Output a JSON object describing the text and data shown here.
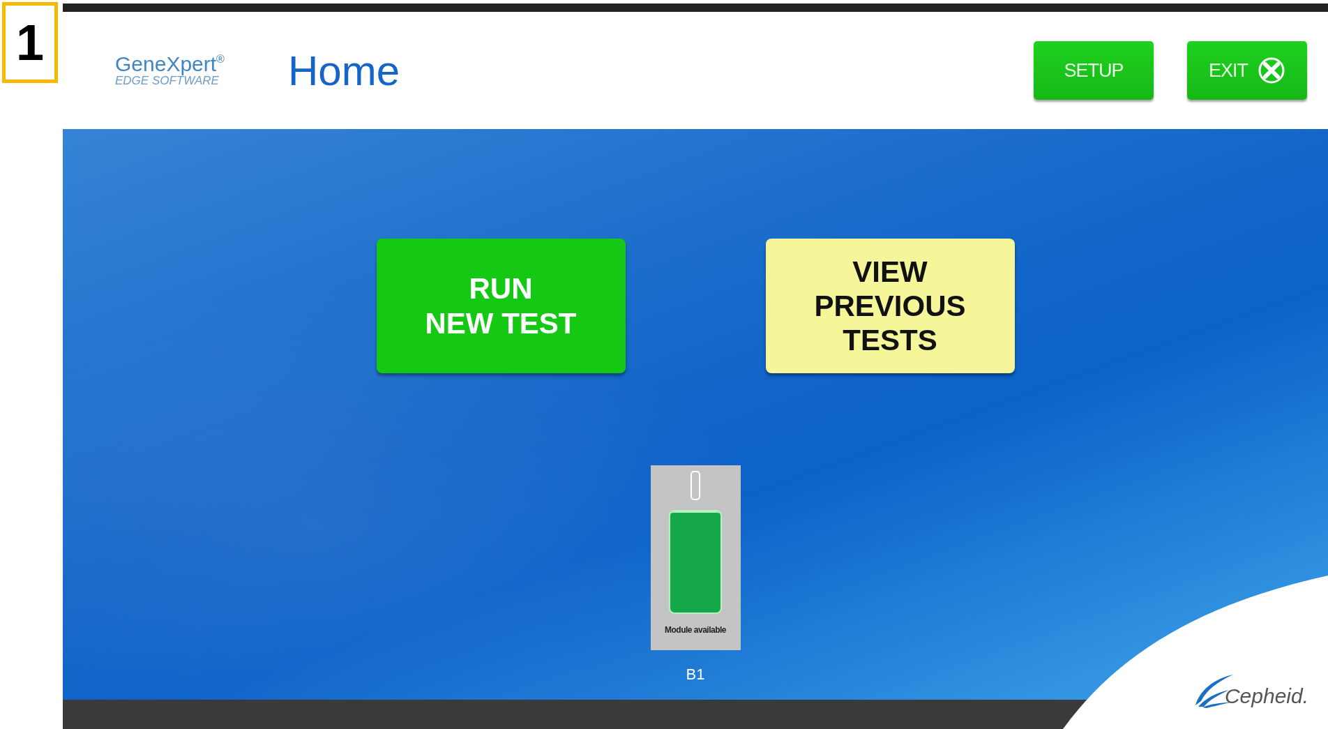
{
  "step_badge": "1",
  "header": {
    "logo": {
      "name": "GeneXpert$^{®}$",
      "subtitle": "EDGE SOFTWARE"
    },
    "title": "Home",
    "buttons": [
      {
        "label": "SETUP",
        "kind": "plain"
      },
      {
        "label": "EXIT",
        "kind": "exit"
      }
    ]
  },
  "actions": [
    {
      "label": "RUN\nNEW TEST",
      "kind": "primary"
    },
    {
      "label": "VIEW\nPREVIOUS\nTESTS",
      "kind": "secondary"
    }
  ],
  "modules": [
    {
      "status": "Module available",
      "label": "B1",
      "kind": "available"
    }
  ],
  "brand": "Cepheid."
}
